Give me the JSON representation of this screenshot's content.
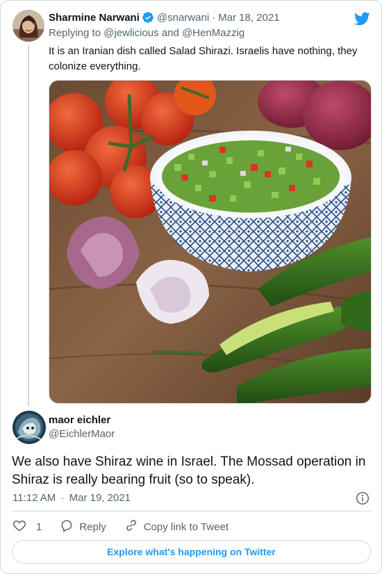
{
  "parent_tweet": {
    "author_name": "Sharmine Narwani",
    "handle": "@snarwani",
    "separator": "·",
    "date": "Mar 18, 2021",
    "replying_prefix": "Replying to",
    "reply_to_1": "@jewlicious",
    "reply_and": "and",
    "reply_to_2": "@HenMazzig",
    "text": "It is an Iranian dish called Salad Shirazi. Israelis have nothing, they colonize everything.",
    "icons": [
      "verified-badge-icon",
      "twitter-bird-icon"
    ]
  },
  "reply_tweet": {
    "author_name": "maor eichler",
    "handle": "@EichlerMaor",
    "text": "We also have Shiraz wine in Israel. The Mossad operation in Shiraz is really bearing fruit (so to speak).",
    "time": "11:12 AM",
    "separator": "·",
    "date": "Mar 19, 2021"
  },
  "actions": {
    "like_count": "1",
    "reply_label": "Reply",
    "copy_link_label": "Copy link to Tweet"
  },
  "footer": {
    "explore_label": "Explore what's happening on Twitter"
  },
  "colors": {
    "accent": "#1d9bf0",
    "muted_text": "#536471",
    "border": "#cfd9de"
  }
}
